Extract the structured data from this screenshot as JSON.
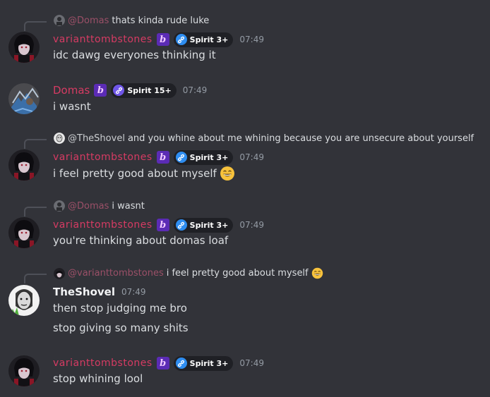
{
  "messages": [
    {
      "reply": {
        "author": "@Domas",
        "text": "thats kinda rude luke"
      },
      "author": "varianttombstones",
      "badge": "Spirit 3+",
      "time": "07:49",
      "lines": [
        "idc dawg everyones thinking it"
      ]
    },
    {
      "author": "Domas",
      "badge": "Spirit 15+",
      "time": "07:49",
      "lines": [
        "i wasnt"
      ]
    },
    {
      "reply": {
        "author": "@TheShovel",
        "text": "and you whine about me whining because you are unsecure about yourself"
      },
      "author": "varianttombstones",
      "badge": "Spirit 3+",
      "time": "07:49",
      "lines": [
        "i feel pretty good about myself"
      ]
    },
    {
      "reply": {
        "author": "@Domas",
        "text": "i wasnt"
      },
      "author": "varianttombstones",
      "badge": "Spirit 3+",
      "time": "07:49",
      "lines": [
        "you're thinking about domas loaf"
      ]
    },
    {
      "reply": {
        "author": "@varianttombstones",
        "text": "i feel pretty good about myself"
      },
      "author": "TheShovel",
      "time": "07:49",
      "lines": [
        "then stop judging me bro",
        "stop giving so many shits"
      ]
    },
    {
      "author": "varianttombstones",
      "badge": "Spirit 3+",
      "time": "07:49",
      "lines": [
        "stop whining lool"
      ]
    }
  ],
  "colors": {
    "background": "#323339",
    "author_pink": "#d63b63",
    "text": "#dbdee1",
    "timestamp": "#949ba4",
    "badge_bg": "#1f2025"
  },
  "icons": [
    "tag-b-icon",
    "link-icon",
    "grin-emoji-icon"
  ]
}
